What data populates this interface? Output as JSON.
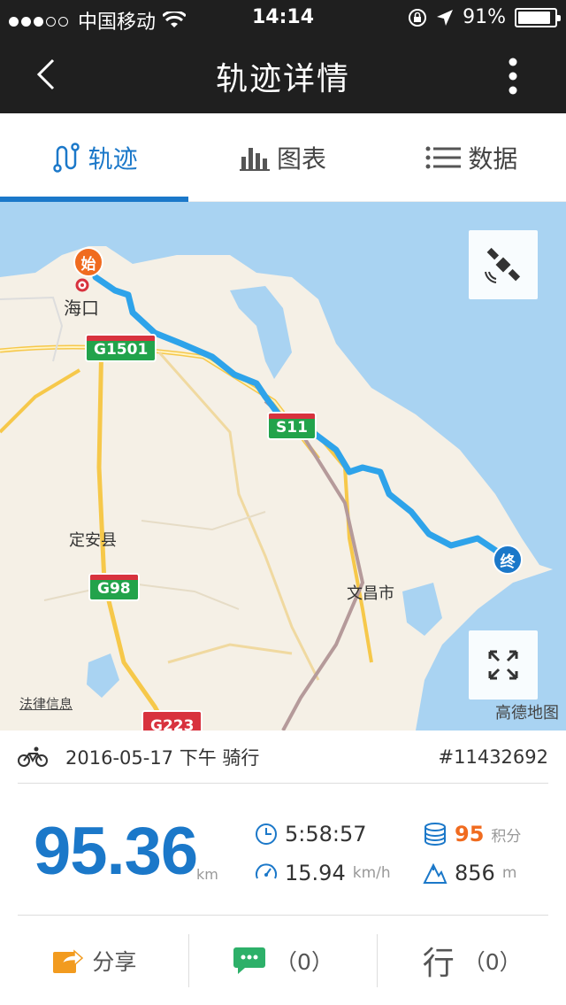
{
  "status_bar": {
    "carrier": "中国移动",
    "time": "14:14",
    "battery": "91%",
    "battery_level": 0.91
  },
  "nav": {
    "title": "轨迹详情"
  },
  "tabs": [
    {
      "label": "轨迹",
      "icon": "track-icon",
      "active": true
    },
    {
      "label": "图表",
      "icon": "bar-chart-icon",
      "active": false
    },
    {
      "label": "数据",
      "icon": "list-icon",
      "active": false
    }
  ],
  "map": {
    "start_marker": "始",
    "end_marker": "终",
    "labels": {
      "haikou": "海口",
      "dingan": "定安县",
      "wenchang": "文昌市"
    },
    "roads": {
      "g1501": "G1501",
      "s11": "S11",
      "g98": "G98",
      "g223": "G223"
    },
    "legal": "法律信息",
    "brand": "高德地图",
    "colors": {
      "route": "#2ea3ea",
      "water": "#a9d3f2",
      "land": "#f5f0e6"
    }
  },
  "ride": {
    "date": "2016-05-17 下午 骑行",
    "id": "#11432692",
    "distance": "95.36",
    "distance_unit": "km",
    "duration": "5:58:57",
    "speed": "15.94",
    "speed_unit": "km/h",
    "points": "95",
    "points_label": "积分",
    "elevation": "856",
    "elevation_unit": "m"
  },
  "actions": {
    "share": "分享",
    "comments": "（0）",
    "xing_char": "行",
    "xing_count": "（0）"
  },
  "colors": {
    "accent": "#1b78c9",
    "orange": "#f06b1f",
    "green": "#2db069"
  }
}
